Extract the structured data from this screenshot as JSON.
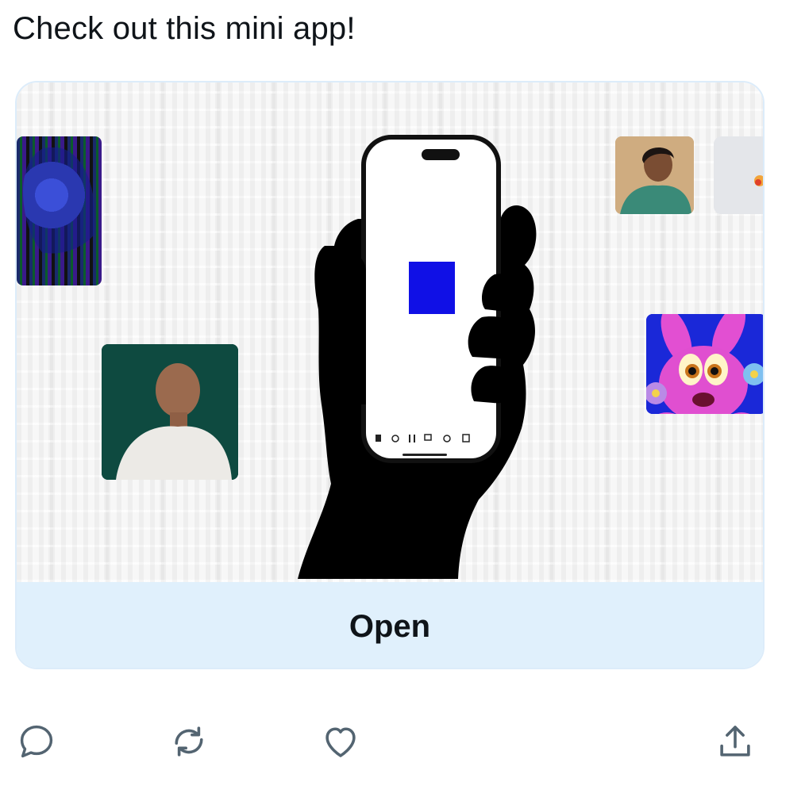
{
  "post": {
    "text": "Check out this mini app!"
  },
  "card": {
    "open_label": "Open"
  },
  "actions": {
    "reply_icon": "reply-icon",
    "repost_icon": "repost-icon",
    "like_icon": "like-icon",
    "share_icon": "share-icon"
  },
  "colors": {
    "card_border": "#dcecfa",
    "open_bar_bg": "#e0f0fc",
    "text": "#0f1419",
    "icon": "#536471",
    "phone_square": "#1010e6"
  }
}
